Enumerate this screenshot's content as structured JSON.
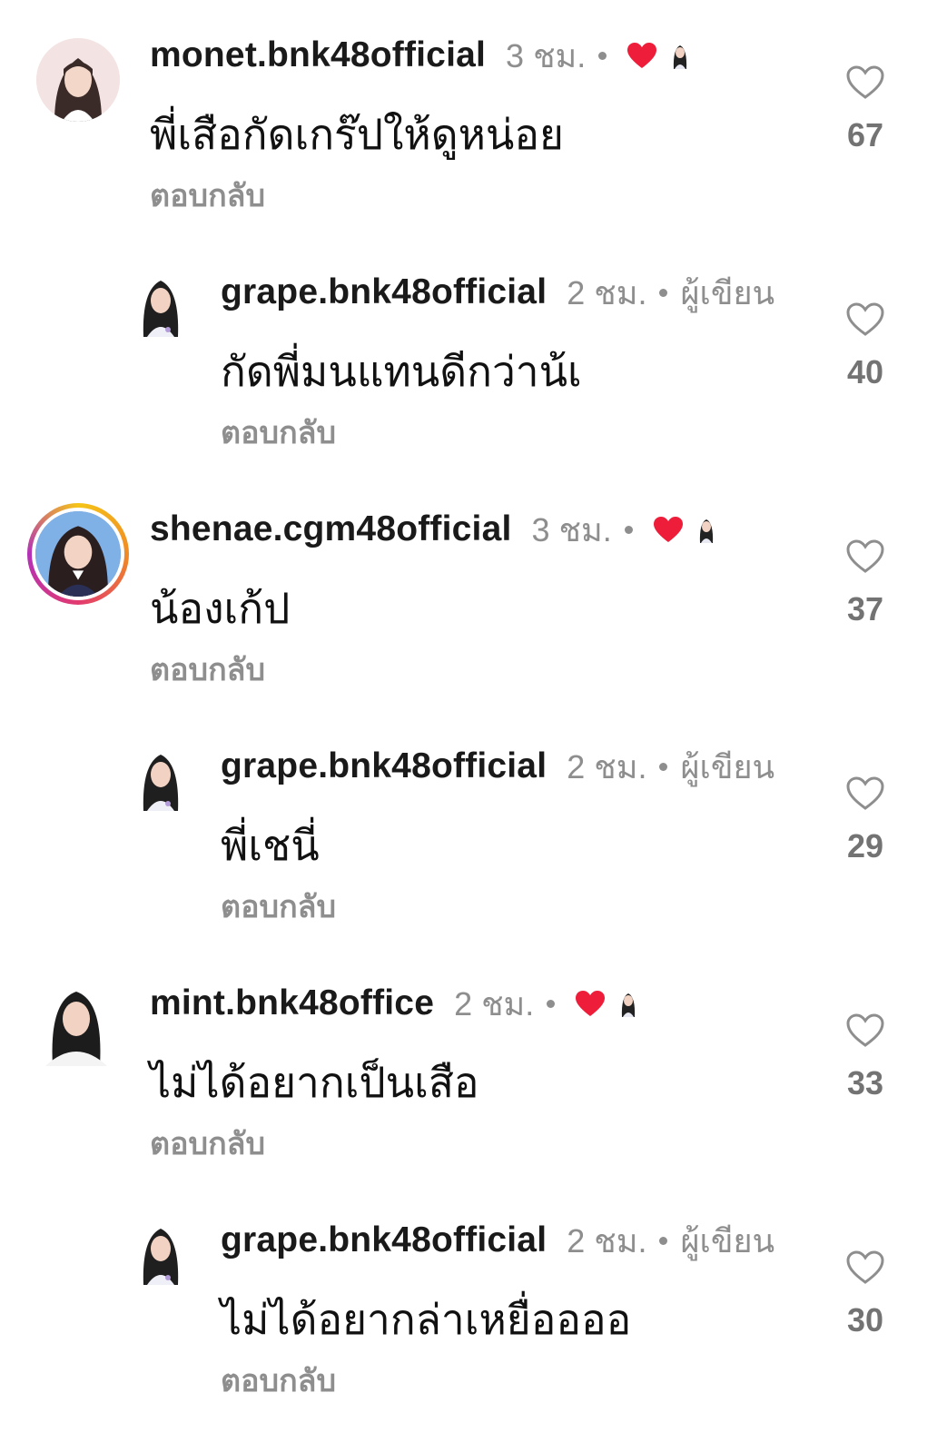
{
  "colors": {
    "liked_heart": "#ee1d3a",
    "muted": "#8e8e8e",
    "text": "#111111"
  },
  "reply_label": "ตอบกลับ",
  "comments": [
    {
      "username": "monet.bnk48official",
      "time": "3 ชม.",
      "text": "พี่เสือกัดเกร๊ปให้ดูหน่อย",
      "likes": "67",
      "is_reply": false,
      "liked_by_creator": true,
      "avatar_icon": "avatar-monet"
    },
    {
      "username": "grape.bnk48official",
      "time": "2 ชม.",
      "author_tag": "ผู้เขียน",
      "text": "กัดพี่มนแทนดีกว่าน้เ",
      "likes": "40",
      "is_reply": true,
      "avatar_icon": "avatar-grape"
    },
    {
      "username": "shenae.cgm48official",
      "time": "3 ชม.",
      "text": "น้องเก้ป",
      "likes": "37",
      "is_reply": false,
      "liked_by_creator": true,
      "avatar_icon": "avatar-shenae-story-ring"
    },
    {
      "username": "grape.bnk48official",
      "time": "2 ชม.",
      "author_tag": "ผู้เขียน",
      "text": "พี่เชนี่",
      "likes": "29",
      "is_reply": true,
      "avatar_icon": "avatar-grape"
    },
    {
      "username": "mint.bnk48office",
      "time": "2 ชม.",
      "text": "ไม่ได้อยากเป็นเสือ",
      "likes": "33",
      "is_reply": false,
      "liked_by_creator": true,
      "avatar_icon": "avatar-mint"
    },
    {
      "username": "grape.bnk48official",
      "time": "2 ชม.",
      "author_tag": "ผู้เขียน",
      "text": "ไม่ได้อยากล่าเหยื่ออออ",
      "likes": "30",
      "is_reply": true,
      "avatar_icon": "avatar-grape"
    }
  ]
}
